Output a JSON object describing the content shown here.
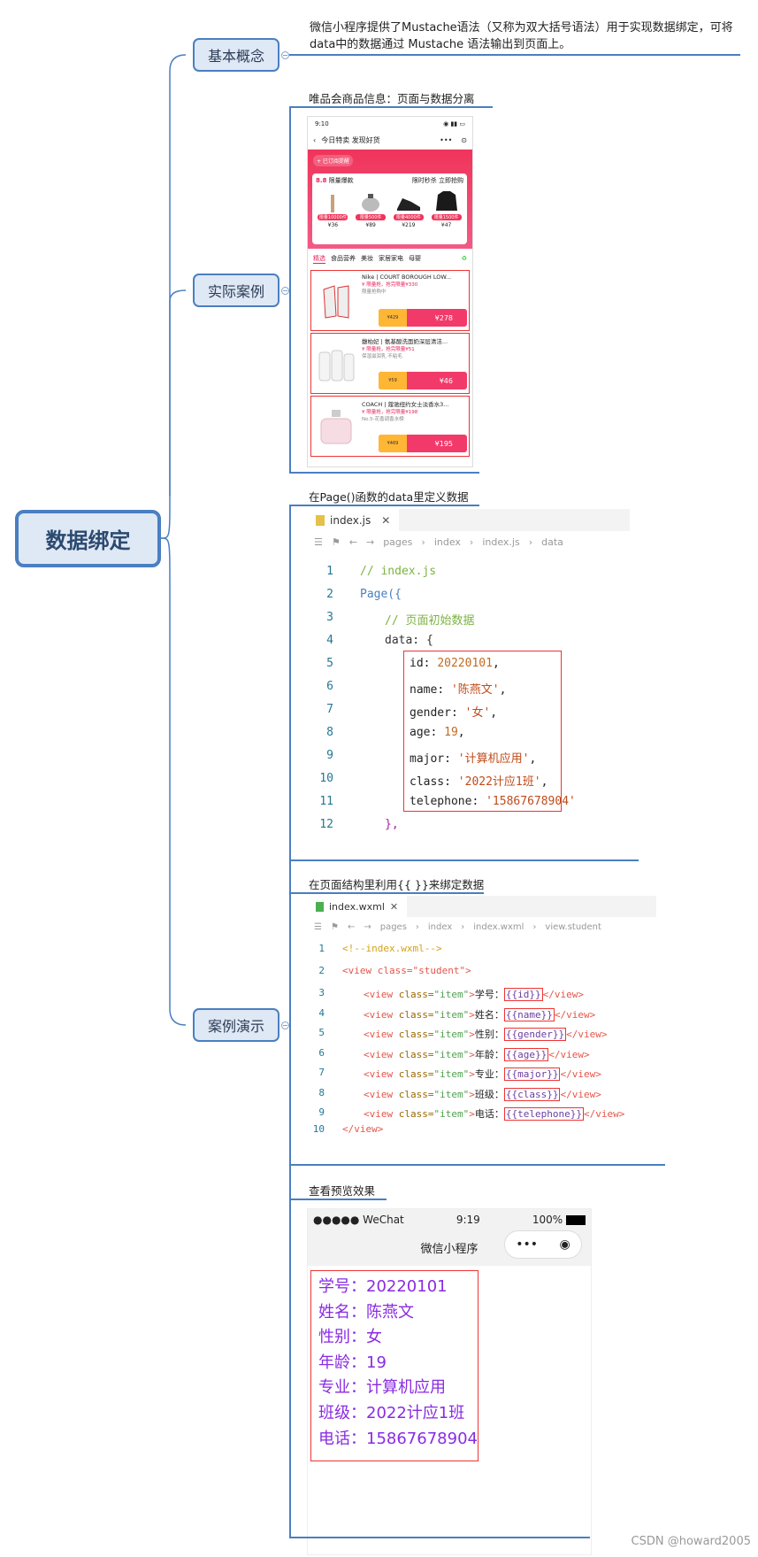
{
  "root": {
    "label": "数据绑定"
  },
  "branches": {
    "concept": {
      "label": "基本概念"
    },
    "case": {
      "label": "实际案例"
    },
    "demo": {
      "label": "案例演示"
    }
  },
  "concept_text": {
    "line1": "微信小程序提供了Mustache语法（又称为双大括号语法）用于实现数据绑定，可将",
    "line2": "data中的数据通过 Mustache 语法输出到页面上。"
  },
  "case_title": "唯品会商品信息：页面与数据分离",
  "vip_phone": {
    "time": "9:10",
    "nav_title": "今日特卖 发现好货",
    "nav_dots": "•••",
    "promo_pill": "+ 已订阅提醒",
    "brand_tag": "8.8",
    "event_title": "限量爆款",
    "event_right": "限时秒杀 立即抢购",
    "products": [
      {
        "tag": "限量10000件",
        "price": "¥36"
      },
      {
        "tag": "限量500件",
        "price": "¥89"
      },
      {
        "tag": "限量4000件",
        "price": "¥219"
      },
      {
        "tag": "限量1500件",
        "price": "¥47"
      }
    ],
    "tabs": [
      "精选",
      "食品营养",
      "美妆",
      "家居家电",
      "母婴"
    ],
    "items": [
      {
        "title": "Nike | COURT BOROUGH LOW...",
        "red": "¥ 限量抢，抢完限量¥330",
        "grey": "限量抢购中",
        "price": "¥278",
        "old": "¥429"
      },
      {
        "title": "馥柏妃 | 氨基酸洗面奶深层清洁...",
        "red": "¥ 限量抢，抢完限量¥51",
        "grey": "保湿滋润乳 不粘毛",
        "price": "¥46",
        "old": "¥59"
      },
      {
        "title": "COACH | 蔻驰纽约女士淡香水3...",
        "red": "¥ 限量抢，抢完限量¥198",
        "grey": "No.5-花香调香水榜",
        "price": "¥195",
        "old": "¥469"
      }
    ]
  },
  "data_title": "在Page()函数的data里定义数据",
  "js_editor": {
    "tab": "index.js",
    "crumbs": [
      "pages",
      "index",
      "index.js",
      "data"
    ],
    "lines": [
      {
        "n": "1",
        "t": "// index.js"
      },
      {
        "n": "2",
        "t": "Page({"
      },
      {
        "n": "3",
        "t": "// 页面初始数据"
      },
      {
        "n": "4",
        "t": "data: {"
      },
      {
        "n": "5",
        "k": "id",
        "v": "20220101"
      },
      {
        "n": "6",
        "k": "name",
        "v": "'陈燕文'"
      },
      {
        "n": "7",
        "k": "gender",
        "v": "'女'"
      },
      {
        "n": "8",
        "k": "age",
        "v": "19"
      },
      {
        "n": "9",
        "k": "major",
        "v": "'计算机应用'"
      },
      {
        "n": "10",
        "k": "class",
        "v": "'2022计应1班'"
      },
      {
        "n": "11",
        "k": "telephone",
        "v": "'15867678904'"
      },
      {
        "n": "12",
        "t": "},"
      }
    ]
  },
  "bind_title": "在页面结构里利用{{ }}来绑定数据",
  "wxml_editor": {
    "tab": "index.wxml",
    "crumbs": [
      "pages",
      "index",
      "index.wxml",
      "view.student"
    ],
    "comment": "<!--index.wxml-->",
    "open_tag": "<view class=\"student\">",
    "close_tag": "</view>",
    "rows": [
      {
        "n": "3",
        "label": "学号：",
        "var": "{{id}}"
      },
      {
        "n": "4",
        "label": "姓名：",
        "var": "{{name}}"
      },
      {
        "n": "5",
        "label": "性别：",
        "var": "{{gender}}"
      },
      {
        "n": "6",
        "label": "年龄：",
        "var": "{{age}}"
      },
      {
        "n": "7",
        "label": "专业：",
        "var": "{{major}}"
      },
      {
        "n": "8",
        "label": "班级：",
        "var": "{{class}}"
      },
      {
        "n": "9",
        "label": "电话：",
        "var": "{{telephone}}"
      }
    ]
  },
  "preview_title": "查看预览效果",
  "preview_phone": {
    "carrier": "●●●●● WeChat",
    "time": "9:19",
    "battery": "100%",
    "title": "微信小程序",
    "rows": [
      "学号：20220101",
      "姓名：陈燕文",
      "性别：女",
      "年龄：19",
      "专业：计算机应用",
      "班级：2022计应1班",
      "电话：15867678904"
    ]
  },
  "watermark": "CSDN @howard2005",
  "colors": {
    "branch_line": "#4a7fc1",
    "highlight_box": "#e33333",
    "preview_text": "#8a2be2"
  }
}
